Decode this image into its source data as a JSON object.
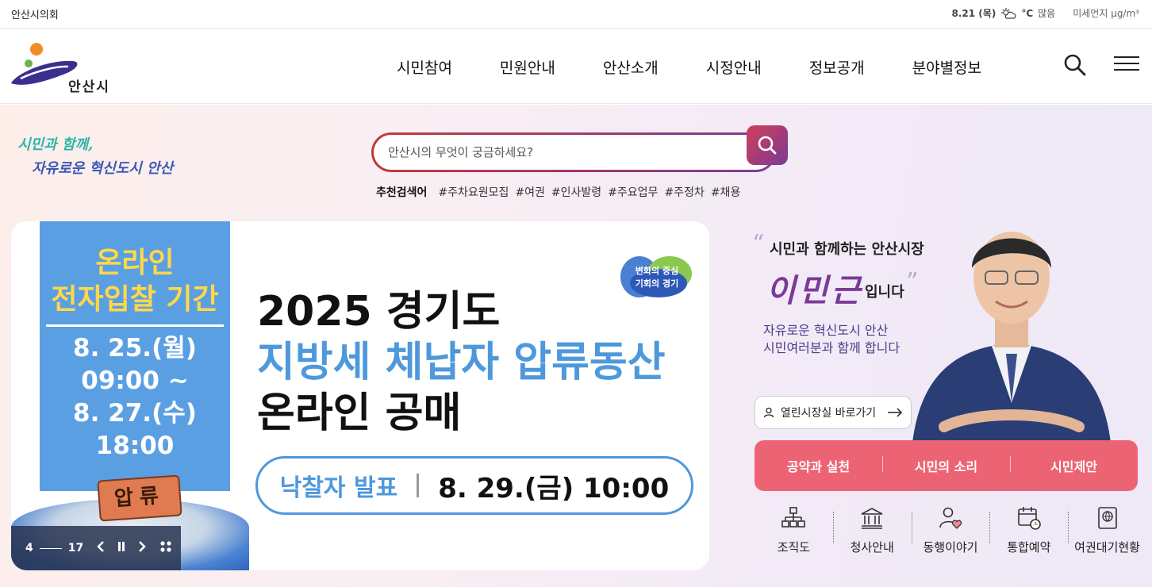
{
  "util": {
    "council": "안산시의회",
    "date": "8.21 (목)",
    "temp": "°C",
    "weather": "많음",
    "dust": "미세먼지 μg/m³"
  },
  "header": {
    "logo_text": "안산시",
    "nav": [
      "시민참여",
      "민원안내",
      "안산소개",
      "시정안내",
      "정보공개",
      "분야별정보"
    ]
  },
  "slogan": {
    "line1": "시민과 함께,",
    "line2": "자유로운 혁신도시 안산"
  },
  "search": {
    "placeholder": "안산시의 무엇이 궁금하세요?",
    "keywords_title": "추천검색어",
    "keywords": [
      "#주차요원모집",
      "#여권",
      "#인사발령",
      "#주요업무",
      "#주정차",
      "#채용"
    ]
  },
  "banner": {
    "left_title1": "온라인",
    "left_title2": "전자입찰 기간",
    "date1": "8. 25.(월)",
    "time1": "09:00 ~",
    "date2": "8. 27.(수)",
    "time2": "18:00",
    "stamp": "압류",
    "badge_line1": "변화의 중심",
    "badge_line2": "기회의 경기",
    "headline1": "2025 경기도",
    "headline2": "지방세 체납자 압류동산",
    "headline3": "온라인 공매",
    "pill_label": "낙찰자 발표",
    "pill_date": "8. 29.(금) 10:00"
  },
  "slider": {
    "current": "4",
    "total": "17"
  },
  "mayor": {
    "title": "시민과 함께하는 안산시장",
    "name": "이민근",
    "suffix": "입니다",
    "desc1": "자유로운 혁신도시 안산",
    "desc2": "시민여러분과 함께 합니다",
    "link": "열린시장실 바로가기",
    "tabs": [
      "공약과 실천",
      "시민의 소리",
      "시민제안"
    ]
  },
  "quick_links": [
    {
      "label": "조직도",
      "icon": "org-chart-icon"
    },
    {
      "label": "청사안내",
      "icon": "building-icon"
    },
    {
      "label": "동행이야기",
      "icon": "people-heart-icon"
    },
    {
      "label": "통합예약",
      "icon": "calendar-clock-icon"
    },
    {
      "label": "여권대기현황",
      "icon": "passport-icon"
    }
  ],
  "colors": {
    "accent_pink": "#ec6474",
    "accent_purple": "#7a3b98",
    "banner_blue": "#4e98dc"
  }
}
